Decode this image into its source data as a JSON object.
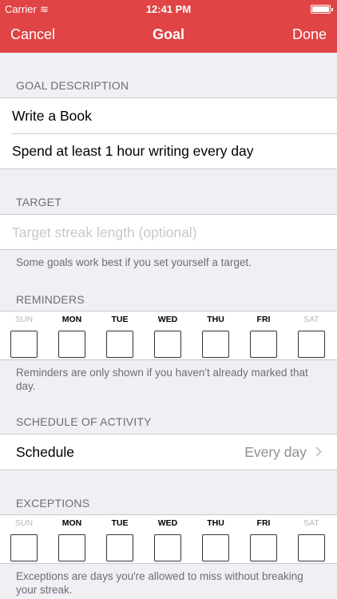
{
  "status_bar": {
    "carrier": "Carrier",
    "wifi_glyph": "≋",
    "time": "12:41 PM"
  },
  "nav": {
    "cancel": "Cancel",
    "title": "Goal",
    "done": "Done"
  },
  "goal_description": {
    "header": "GOAL DESCRIPTION",
    "title_value": "Write a Book",
    "detail_value": "Spend at least 1 hour writing every day"
  },
  "target": {
    "header": "TARGET",
    "placeholder": "Target streak length (optional)",
    "footer": "Some goals work best if you set yourself a target."
  },
  "reminders": {
    "header": "REMINDERS",
    "days": [
      "SUN",
      "MON",
      "TUE",
      "WED",
      "THU",
      "FRI",
      "SAT"
    ],
    "footer": "Reminders are only shown if you haven't already marked that day."
  },
  "schedule": {
    "header": "SCHEDULE OF ACTIVITY",
    "label": "Schedule",
    "value": "Every day"
  },
  "exceptions": {
    "header": "EXCEPTIONS",
    "days": [
      "SUN",
      "MON",
      "TUE",
      "WED",
      "THU",
      "FRI",
      "SAT"
    ],
    "footer": "Exceptions are days you're allowed to miss without breaking your streak."
  },
  "colors": {
    "accent": "#e04444",
    "background": "#efeff4",
    "secondary_text": "#6d6d72"
  }
}
